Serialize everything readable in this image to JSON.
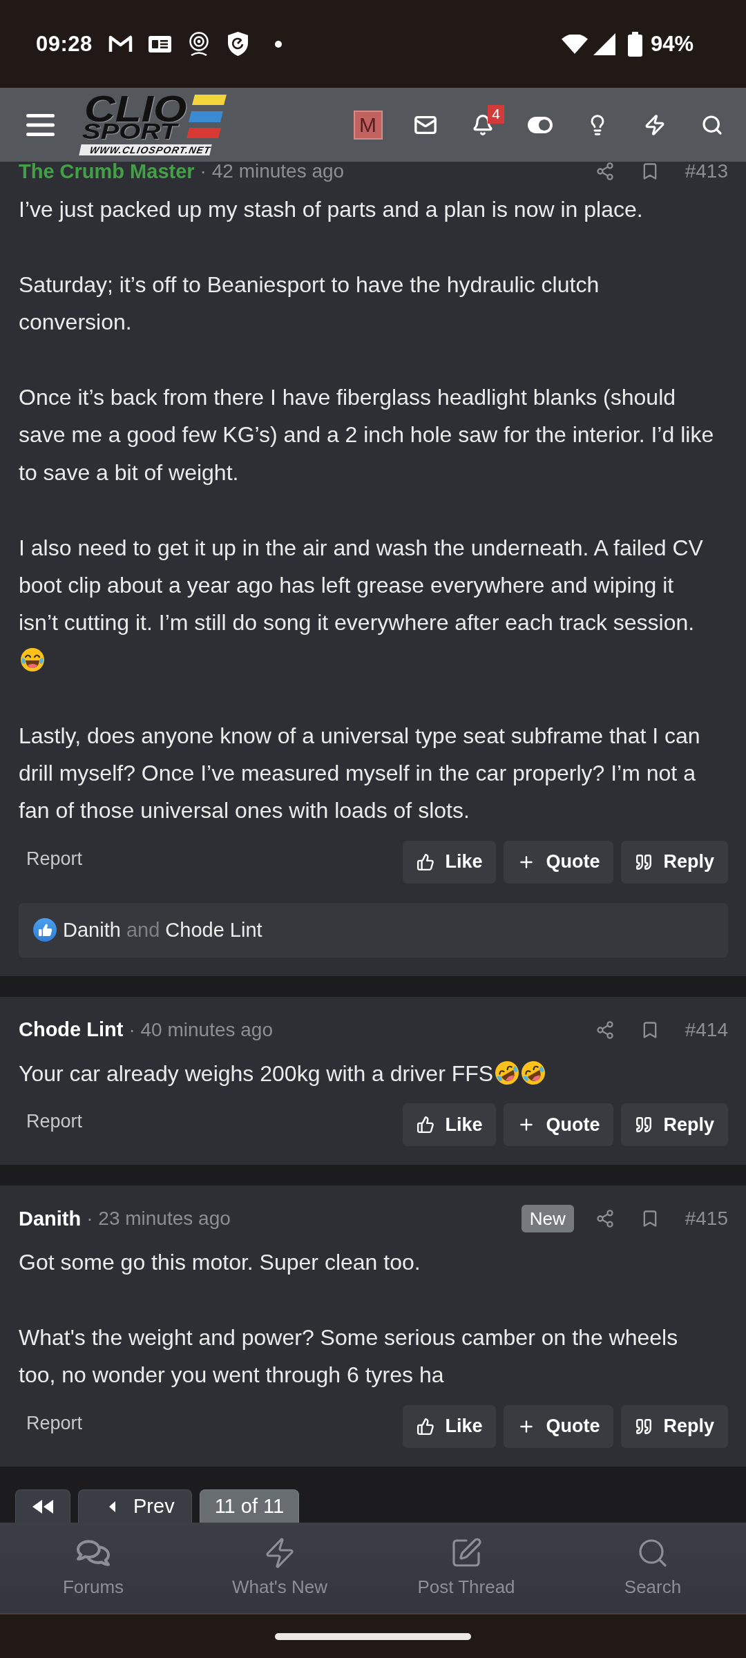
{
  "status_bar": {
    "time": "09:28",
    "battery": "94%"
  },
  "header": {
    "logo": {
      "wordmark_top": "CLIO",
      "wordmark_bottom": "SPORT",
      "url": "WWW.CLIOSPORT.NET"
    },
    "avatar_letter": "M",
    "alerts_badge": "4"
  },
  "posts": [
    {
      "author": {
        "name": "The Crumb Master",
        "color": "#43a047"
      },
      "time": "· 42 minutes ago",
      "number": "#413",
      "body": [
        {
          "text": "I’ve just packed up my stash of parts and a plan is now in place."
        },
        {
          "text": "Saturday; it’s off to Beaniesport to have the hydraulic clutch conversion."
        },
        {
          "text": "Once it’s back from there I have fiberglass headlight blanks (should save me a good few KG’s) and a 2 inch hole saw for the interior. I’d like to save a bit of weight."
        },
        {
          "text": "I also need to get it up in the air and wash the underneath. A failed CV boot clip about a year ago has left grease everywhere and wiping it isn’t cutting it. I’m still do song it everywhere after each track session.",
          "emojis": [
            {
              "kind": "joy"
            }
          ]
        },
        {
          "text": "Lastly, does anyone know of a universal type seat subframe that I can drill myself? Once I’ve measured myself in the car properly? I’m not a fan of those universal ones with loads of slots."
        }
      ],
      "report": "Report",
      "actions": [
        {
          "kind": "like",
          "label": "Like"
        },
        {
          "kind": "quote",
          "label": "Quote"
        },
        {
          "kind": "reply",
          "label": "Reply"
        }
      ],
      "likes": {
        "names": [
          "Danith",
          "Chode Lint"
        ],
        "joiner": "and"
      }
    },
    {
      "author": {
        "name": "Chode Lint",
        "color": "#ffffff"
      },
      "time": "· 40 minutes ago",
      "number": "#414",
      "body": [
        {
          "text": "Your car already weighs 200kg with a driver FFS",
          "emojis": [
            {
              "kind": "rofl"
            },
            {
              "kind": "rofl"
            }
          ]
        }
      ],
      "report": "Report",
      "actions": [
        {
          "kind": "like",
          "label": "Like"
        },
        {
          "kind": "quote",
          "label": "Quote"
        },
        {
          "kind": "reply",
          "label": "Reply"
        }
      ]
    },
    {
      "author": {
        "name": "Danith",
        "color": "#ffffff"
      },
      "time": "· 23 minutes ago",
      "badge": "New",
      "number": "#415",
      "body": [
        {
          "text": "Got some go this motor. Super clean too."
        },
        {
          "text": "What's the weight and power? Some serious camber on the wheels too, no wonder you went through 6 tyres ha"
        }
      ],
      "report": "Report",
      "actions": [
        {
          "kind": "like",
          "label": "Like"
        },
        {
          "kind": "quote",
          "label": "Quote"
        },
        {
          "kind": "reply",
          "label": "Reply"
        }
      ]
    }
  ],
  "pagination": [
    {
      "kind": "first",
      "selected": false
    },
    {
      "kind": "prev",
      "label": "Prev",
      "selected": false
    },
    {
      "kind": "page",
      "label": "11 of 11",
      "selected": true
    }
  ],
  "bottom_nav": [
    {
      "kind": "forums",
      "label": "Forums"
    },
    {
      "kind": "whats_new",
      "label": "What's New"
    },
    {
      "kind": "post_thread",
      "label": "Post Thread"
    },
    {
      "kind": "search",
      "label": "Search"
    }
  ]
}
